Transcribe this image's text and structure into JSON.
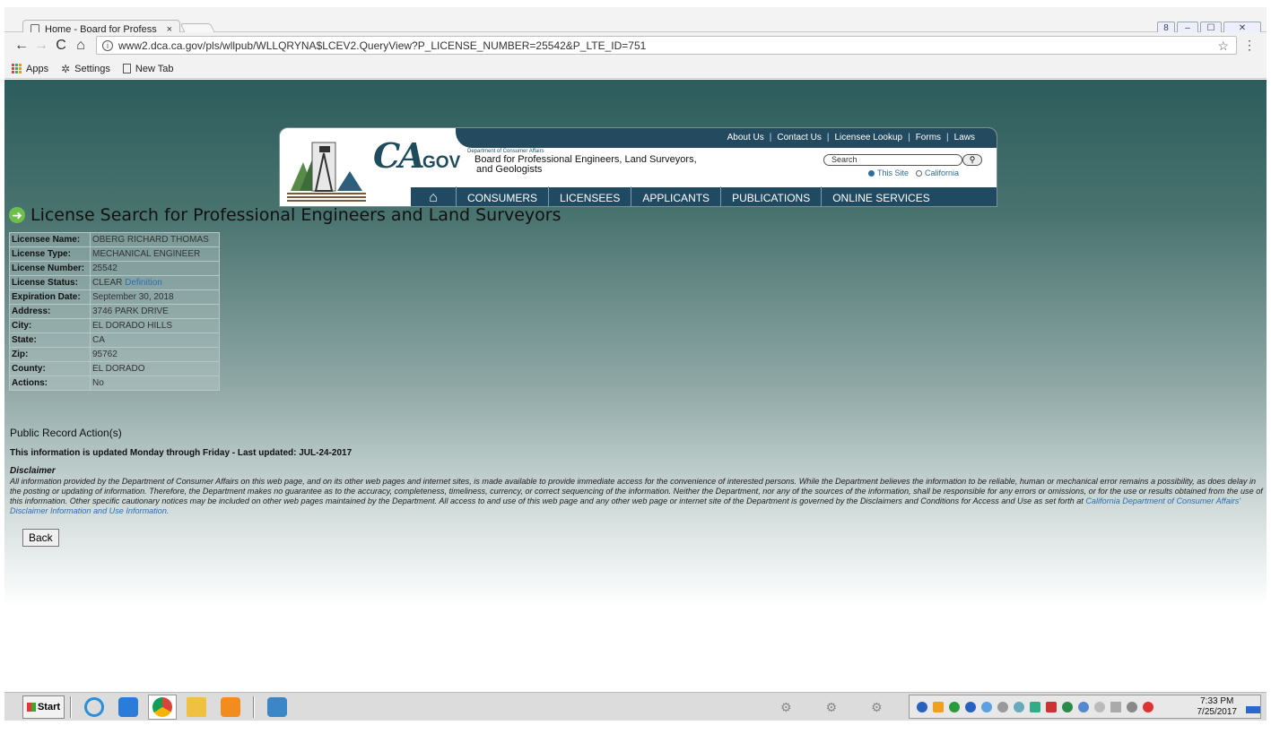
{
  "browser": {
    "tab_title": "Home - Board for Profess",
    "tab_close": "×",
    "url": "www2.dca.ca.gov/pls/wllpub/WLLQRYNA$LCEV2.QueryView?P_LICENSE_NUMBER=25542&P_LTE_ID=751",
    "window_buttons": [
      "8",
      "–",
      "☐",
      "✕"
    ],
    "bookmarks": [
      "Apps",
      "Settings",
      "New Tab"
    ]
  },
  "banner": {
    "top_links": [
      "About Us",
      "Contact Us",
      "Licensee Lookup",
      "Forms",
      "Laws"
    ],
    "logo_ca": "CA",
    "logo_gov": ".GOV",
    "dept": "Department of Consumer Affairs",
    "board_line1": "Board for Professional Engineers, Land Surveyors,",
    "board_line2": "and Geologists",
    "search_placeholder": "Search",
    "radio_site": "This Site",
    "radio_ca": "California",
    "nav": [
      "CONSUMERS",
      "LICENSEES",
      "APPLICANTS",
      "PUBLICATIONS",
      "ONLINE SERVICES"
    ]
  },
  "heading": "License Search for Professional Engineers and Land Surveyors",
  "license": [
    {
      "key": "Licensee Name:",
      "value": "OBERG RICHARD THOMAS"
    },
    {
      "key": "License Type:",
      "value": "MECHANICAL ENGINEER"
    },
    {
      "key": "License Number:",
      "value": "25542"
    },
    {
      "key": "License Status:",
      "value": "CLEAR",
      "link": "Definition"
    },
    {
      "key": "Expiration Date:",
      "value": "September 30, 2018"
    },
    {
      "key": "Address:",
      "value": "3746 PARK DRIVE"
    },
    {
      "key": "City:",
      "value": "EL DORADO HILLS"
    },
    {
      "key": "State:",
      "value": "CA"
    },
    {
      "key": "Zip:",
      "value": "95762"
    },
    {
      "key": "County:",
      "value": "EL DORADO"
    },
    {
      "key": "Actions:",
      "value": "No"
    }
  ],
  "public_record": "Public Record Action(s)",
  "updated": "This information is updated Monday through Friday - Last updated: JUL-24-2017",
  "disclaimer_title": "Disclaimer",
  "disclaimer_body": "All information provided by the Department of Consumer Affairs on this web page, and on its other web pages and internet sites, is made available to provide immediate access for the convenience of interested persons. While the Department believes the information to be reliable, human or mechanical error remains a possibility, as does delay in the posting or updating of information. Therefore, the Department makes no guarantee as to the accuracy, completeness, timeliness, currency, or correct sequencing of the information. Neither the Department, nor any of the sources of the information, shall be responsible for any errors or omissions, or for the use or results obtained from the use of this information. Other specific cautionary notices may be included on other web pages maintained by the Department. All access to and use of this web page and any other web page or internet site of the Department is governed by the Disclaimers and Conditions for Access and Use as set forth at ",
  "disclaimer_link": "California Department of Consumer Affairs' Disclaimer Information and Use Information.",
  "back_label": "Back",
  "taskbar": {
    "start": "Start",
    "time": "7:33 PM",
    "date": "7/25/2017"
  }
}
